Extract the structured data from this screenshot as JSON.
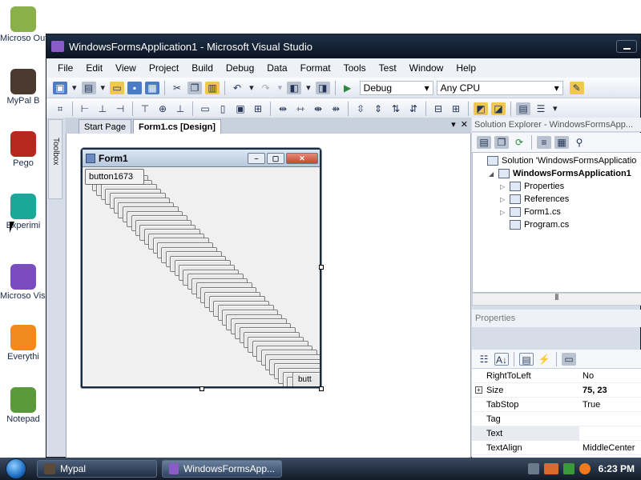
{
  "desktop": {
    "icons": [
      {
        "label": "Microso Outloo",
        "color": "#8ab04a"
      },
      {
        "label": "MyPal B",
        "color": "#4a3a30"
      },
      {
        "label": "Pego",
        "color": "#b4281e"
      },
      {
        "label": "Experimi",
        "color": "#1aa89a"
      },
      {
        "label": "Microso Visual Stu",
        "color": "#7a4cc0"
      },
      {
        "label": "Everythi",
        "color": "#f08a1c"
      },
      {
        "label": "Notepad",
        "color": "#5a9a3a"
      }
    ]
  },
  "window": {
    "title": "WindowsFormsApplication1 - Microsoft Visual Studio"
  },
  "menu": [
    "File",
    "Edit",
    "View",
    "Project",
    "Build",
    "Debug",
    "Data",
    "Format",
    "Tools",
    "Test",
    "Window",
    "Help"
  ],
  "toolbar": {
    "config": "Debug",
    "platform": "Any CPU"
  },
  "toolbox": {
    "label": "Toolbox"
  },
  "tabs": [
    {
      "label": "Start Page",
      "active": false
    },
    {
      "label": "Form1.cs [Design]",
      "active": true
    }
  ],
  "form": {
    "title": "Form1",
    "button_label": "button1673",
    "stack_label": "butt"
  },
  "solution_explorer": {
    "header": "Solution Explorer - WindowsFormsApp...",
    "items": [
      {
        "label": "Solution 'WindowsFormsApplicatio",
        "indent": 0
      },
      {
        "label": "WindowsFormsApplication1",
        "indent": 1,
        "bold": true
      },
      {
        "label": "Properties",
        "indent": 2
      },
      {
        "label": "References",
        "indent": 2
      },
      {
        "label": "Form1.cs",
        "indent": 2
      },
      {
        "label": "Program.cs",
        "indent": 2
      }
    ]
  },
  "properties": {
    "header": "Properties",
    "rows": [
      {
        "name": "RightToLeft",
        "value": "No",
        "bold": false,
        "expandable": false
      },
      {
        "name": "Size",
        "value": "75, 23",
        "bold": true,
        "expandable": true
      },
      {
        "name": "TabStop",
        "value": "True",
        "bold": false,
        "expandable": false
      },
      {
        "name": "Tag",
        "value": "",
        "bold": false,
        "expandable": false
      },
      {
        "name": "Text",
        "value": "",
        "bold": false,
        "expandable": false,
        "selected": true
      },
      {
        "name": "TextAlign",
        "value": "MiddleCenter",
        "bold": false,
        "expandable": false
      }
    ]
  },
  "taskbar": {
    "buttons": [
      "Mypal",
      "WindowsFormsApp..."
    ],
    "clock": "6:23 PM"
  }
}
